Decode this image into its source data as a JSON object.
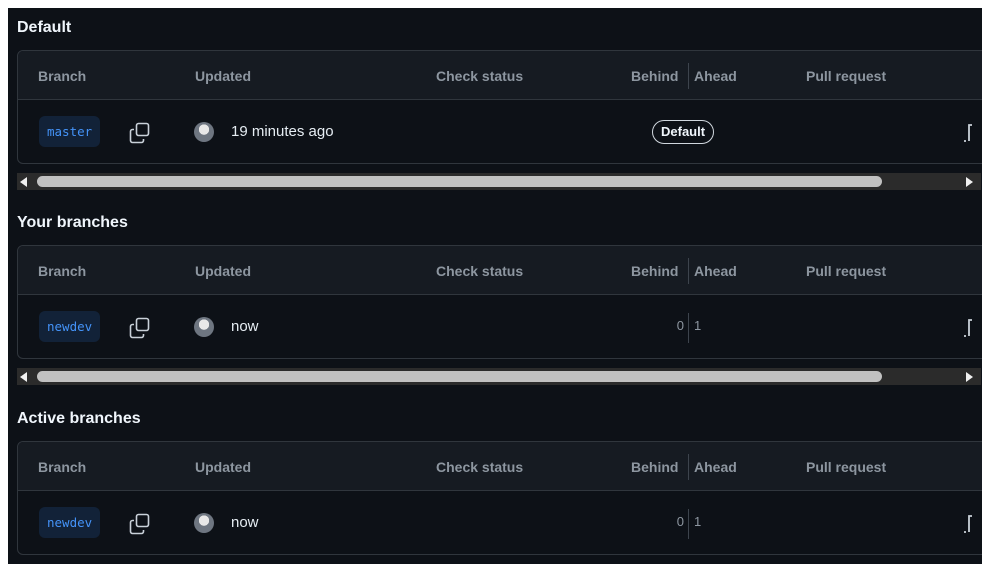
{
  "columns": {
    "branch": "Branch",
    "updated": "Updated",
    "check_status": "Check status",
    "behind": "Behind",
    "ahead": "Ahead",
    "pull_request": "Pull request"
  },
  "sections": [
    {
      "title": "Default",
      "rows": [
        {
          "branch": "master",
          "updated": "19 minutes ago",
          "badge": "Default",
          "behind": "",
          "ahead": ""
        }
      ],
      "scroll_fraction": 0.9
    },
    {
      "title": "Your branches",
      "rows": [
        {
          "branch": "newdev",
          "updated": "now",
          "badge": "",
          "behind": "0",
          "ahead": "1"
        }
      ],
      "scroll_fraction": 0.9
    },
    {
      "title": "Active branches",
      "rows": [
        {
          "branch": "newdev",
          "updated": "now",
          "badge": "",
          "behind": "0",
          "ahead": "1"
        }
      ],
      "scroll_fraction": 0.9
    }
  ],
  "icons": {
    "copy": "copy-icon",
    "avatar": "avatar",
    "more": "kebab-more-icon"
  },
  "colors": {
    "background": "#0d1117",
    "header": "#161b22",
    "border": "#30363d",
    "branch_text": "#4493f8",
    "branch_chip": "#122238"
  }
}
